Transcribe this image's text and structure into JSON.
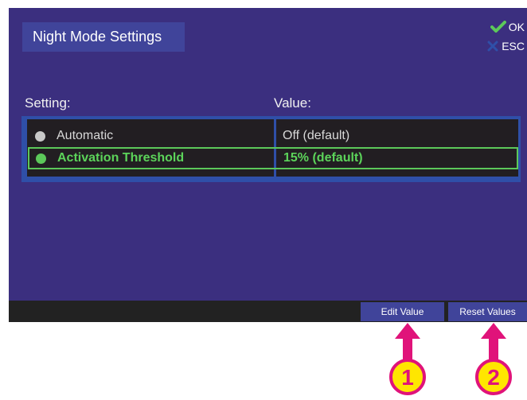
{
  "header": {
    "title": "Night Mode Settings"
  },
  "keys": {
    "ok_label": "OK",
    "esc_label": "ESC",
    "ok_icon": "checkmark-icon",
    "esc_icon": "x-icon"
  },
  "table": {
    "setting_header": "Setting:",
    "value_header": "Value:",
    "rows": [
      {
        "setting": "Automatic",
        "value": "Off (default)",
        "selected": false
      },
      {
        "setting": "Activation Threshold",
        "value": "15% (default)",
        "selected": true
      }
    ]
  },
  "footer": {
    "edit_label": "Edit Value",
    "reset_label": "Reset Values"
  },
  "callouts": {
    "one": "1",
    "two": "2"
  },
  "colors": {
    "screen_bg": "#3b2f7f",
    "title_bg": "#40449a",
    "table_frame": "#2f4fa8",
    "cell_bg": "#221e22",
    "selected_green": "#5cc85a",
    "callout_magenta": "#e0137a",
    "callout_yellow": "#ffe600"
  }
}
